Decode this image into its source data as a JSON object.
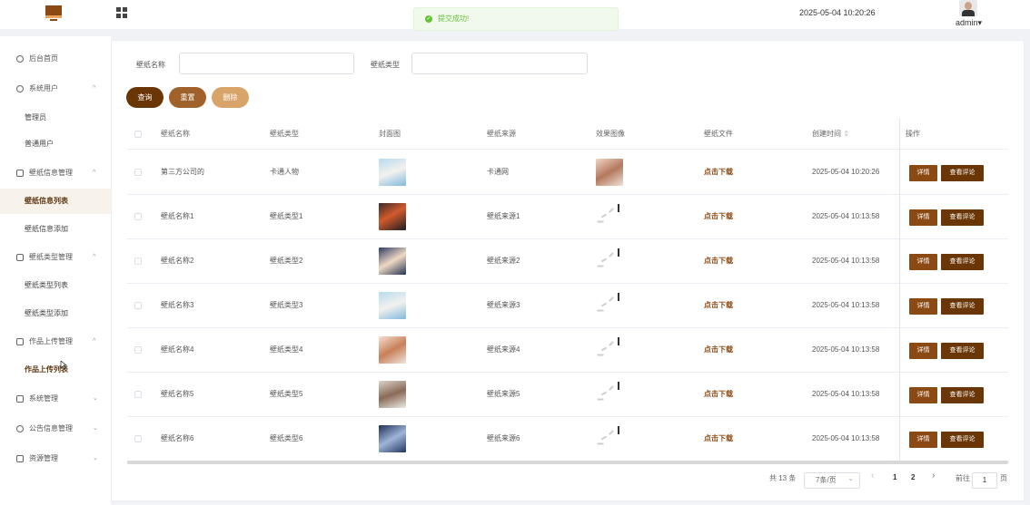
{
  "header": {
    "toast": "提交成功!",
    "datetime": "2025-05-04 10:20:26",
    "user": "admin",
    "user_caret": "▾"
  },
  "sidebar": {
    "items": [
      {
        "label": "后台首页"
      },
      {
        "label": "系统用户",
        "chevron": "^"
      },
      {
        "label": "管理员"
      },
      {
        "label": "普通用户"
      },
      {
        "label": "壁纸信息管理",
        "chevron": "^"
      },
      {
        "label": "壁纸信息列表"
      },
      {
        "label": "壁纸信息添加"
      },
      {
        "label": "壁纸类型管理",
        "chevron": "^"
      },
      {
        "label": "壁纸类型列表"
      },
      {
        "label": "壁纸类型添加"
      },
      {
        "label": "作品上传管理",
        "chevron": "^"
      },
      {
        "label": "作品上传列表"
      },
      {
        "label": "系统管理",
        "chevron": "⌄"
      },
      {
        "label": "公告信息管理",
        "chevron": "⌄"
      },
      {
        "label": "资源管理",
        "chevron": "⌄"
      }
    ]
  },
  "search": {
    "name_label": "壁纸名称",
    "type_label": "壁纸类型",
    "name_value": "",
    "type_value": "",
    "query_btn": "查询",
    "reset_btn": "重置",
    "delete_btn": "删除"
  },
  "table": {
    "headers": [
      "壁纸名称",
      "壁纸类型",
      "封面图",
      "壁纸来源",
      "效果图像",
      "壁纸文件",
      "创建时间",
      "操作"
    ],
    "sort_icon": "⇕",
    "rows": [
      {
        "name": "第三方公司的",
        "type": "卡通人物",
        "source": "卡通网",
        "file": "点击下载",
        "time": "2025-05-04 10:20:26",
        "detail": "详情",
        "comment": "查看评论"
      },
      {
        "name": "壁纸名称1",
        "type": "壁纸类型1",
        "source": "壁纸来源1",
        "file": "点击下载",
        "time": "2025-05-04 10:13:58",
        "detail": "详情",
        "comment": "查看评论"
      },
      {
        "name": "壁纸名称2",
        "type": "壁纸类型2",
        "source": "壁纸来源2",
        "file": "点击下载",
        "time": "2025-05-04 10:13:58",
        "detail": "详情",
        "comment": "查看评论"
      },
      {
        "name": "壁纸名称3",
        "type": "壁纸类型3",
        "source": "壁纸来源3",
        "file": "点击下载",
        "time": "2025-05-04 10:13:58",
        "detail": "详情",
        "comment": "查看评论"
      },
      {
        "name": "壁纸名称4",
        "type": "壁纸类型4",
        "source": "壁纸来源4",
        "file": "点击下载",
        "time": "2025-05-04 10:13:58",
        "detail": "详情",
        "comment": "查看评论"
      },
      {
        "name": "壁纸名称5",
        "type": "壁纸类型5",
        "source": "壁纸来源5",
        "file": "点击下载",
        "time": "2025-05-04 10:13:58",
        "detail": "详情",
        "comment": "查看评论"
      },
      {
        "name": "壁纸名称6",
        "type": "壁纸类型6",
        "source": "壁纸来源6",
        "file": "点击下载",
        "time": "2025-05-04 10:13:58",
        "detail": "详情",
        "comment": "查看评论"
      }
    ]
  },
  "pagination": {
    "total": "共 13 条",
    "page_size": "7条/页",
    "prev": "‹",
    "pages": [
      "1",
      "2"
    ],
    "next": "›",
    "goto_label": "前往",
    "goto_value": "1",
    "page_unit": "页"
  },
  "colors": {
    "brand": "#8b4a14",
    "brand_dark": "#6b3606",
    "btn_reset": "#a0612a",
    "btn_delete": "#d9a46a",
    "success": "#67c23a"
  }
}
